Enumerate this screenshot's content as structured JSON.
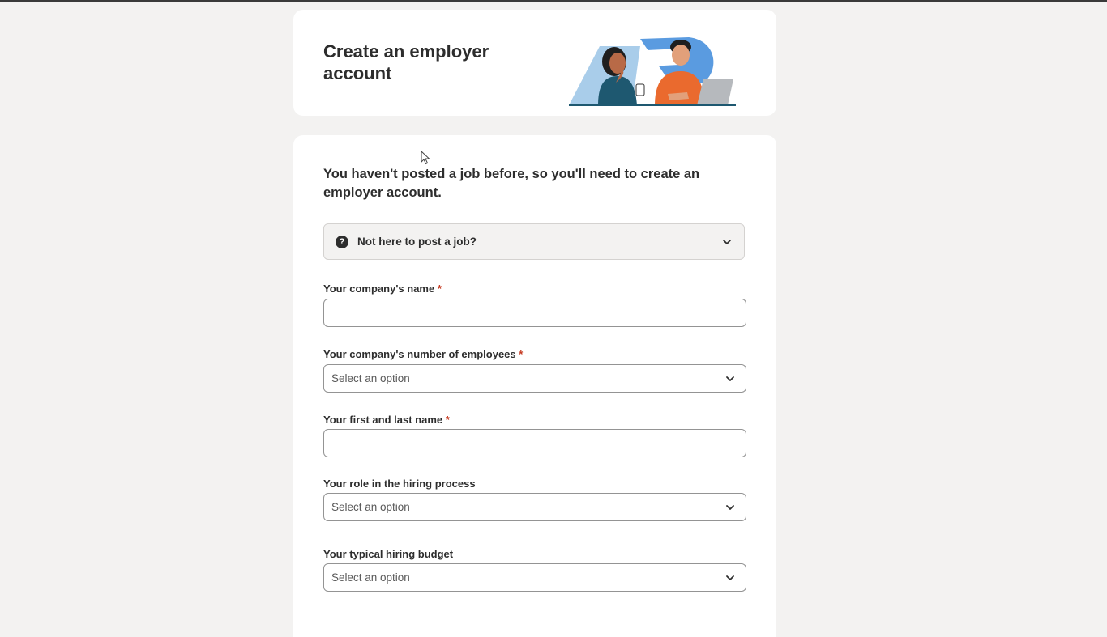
{
  "header": {
    "title": "Create an employer account"
  },
  "intro": {
    "text": "You haven't posted a job before, so you'll need to create an employer account."
  },
  "accordion": {
    "label": "Not here to post a job?",
    "icon": "question-circle-icon"
  },
  "fields": {
    "company_name": {
      "label": "Your company's name",
      "required_mark": "*",
      "value": ""
    },
    "employees": {
      "label": "Your company's number of employees",
      "required_mark": "*",
      "selected": "Select an option"
    },
    "full_name": {
      "label": "Your first and last name",
      "required_mark": "*",
      "value": ""
    },
    "role": {
      "label": "Your role in the hiring process",
      "selected": "Select an option"
    },
    "budget": {
      "label": "Your typical hiring budget",
      "selected": "Select an option"
    }
  },
  "colors": {
    "page_bg": "#f3f2f1",
    "card_bg": "#ffffff",
    "text": "#2d2d2d",
    "required": "#c5381f",
    "border": "#949494"
  }
}
